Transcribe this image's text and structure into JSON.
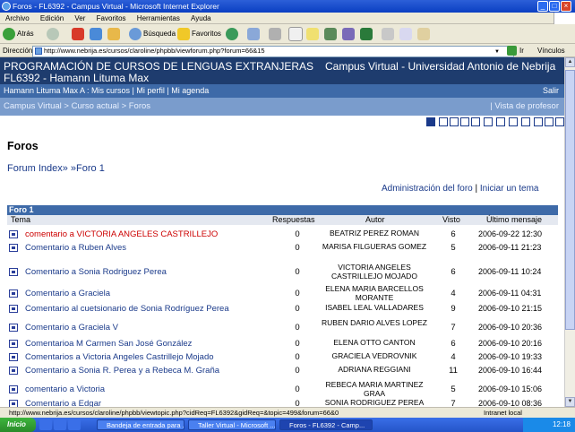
{
  "window": {
    "title": "Foros - FL6392 - Campus Virtual - Microsoft Internet Explorer"
  },
  "menu": [
    "Archivo",
    "Edición",
    "Ver",
    "Favoritos",
    "Herramientas",
    "Ayuda"
  ],
  "toolbar": {
    "back": "Atrás",
    "search": "Búsqueda",
    "favorites": "Favoritos"
  },
  "address": {
    "label": "Dirección",
    "url": "http://www.nebrija.es/cursos/claroline/phpbb/viewforum.php?forum=66&15",
    "go": "Ir",
    "links": "Vínculos"
  },
  "banner": {
    "line1": "PROGRAMACIÓN DE CURSOS DE LENGUAS EXTRANJERAS",
    "line2": "FL6392 - Hamann Lituma Max",
    "right": "Campus Virtual - Universidad Antonio de Nebrija"
  },
  "userbar": {
    "text": "Hamann Lituma Max A : Mis cursos | Mi perfil | Mi agenda",
    "logout": "Salir"
  },
  "crumbs": {
    "text": "Campus Virtual > Curso actual > Foros",
    "view": "|  Vista de profesor"
  },
  "page": {
    "title": "Foros",
    "nav": "Forum Index» »Foro 1"
  },
  "admin": {
    "admin_link": "Administración del foro",
    "sep": "|",
    "new_topic": "Iniciar un tema"
  },
  "forum": {
    "name": "Foro 1",
    "columns": {
      "tema": "Tema",
      "respuestas": "Respuestas",
      "autor": "Autor",
      "visto": "Visto",
      "ultimo": "Último mensaje"
    },
    "rows": [
      {
        "tema": "comentario a VICTORIA ANGELES CASTRILLEJO",
        "hot": true,
        "resp": "0",
        "autor": "BEATRIZ PEREZ ROMAN",
        "visto": "6",
        "ultimo": "2006-09-22 12:30"
      },
      {
        "tema": "Comentario a Ruben Alves",
        "resp": "0",
        "autor": "MARISA FILGUERAS GOMEZ",
        "visto": "5",
        "ultimo": "2006-09-11 21:23"
      },
      {
        "tema": "Comentario a Sonia Rodriguez Perea",
        "resp": "0",
        "autor": "VICTORIA ANGELES CASTRILLEJO MOJADO",
        "visto": "6",
        "ultimo": "2006-09-11 10:24"
      },
      {
        "tema": "Comentario a Graciela",
        "resp": "0",
        "autor": "ELENA MARIA BARCELLOS MORANTE",
        "visto": "4",
        "ultimo": "2006-09-11 04:31"
      },
      {
        "tema": "Comentario al cuetsionario de Sonia Rodríguez Perea",
        "resp": "0",
        "autor": "ISABEL LEAL VALLADARES",
        "visto": "9",
        "ultimo": "2006-09-10 21:15"
      },
      {
        "tema": "Comentario a Graciela V",
        "resp": "0",
        "autor": "RUBEN DARIO ALVES LOPEZ",
        "visto": "7",
        "ultimo": "2006-09-10 20:36"
      },
      {
        "tema": "Comentarioa M Carmen San José González",
        "resp": "0",
        "autor": "ELENA OTTO CANTON",
        "visto": "6",
        "ultimo": "2006-09-10 20:16"
      },
      {
        "tema": "Comentarios a Victoria Angeles Castrillejo Mojado",
        "resp": "0",
        "autor": "GRACIELA VEDROVNIK",
        "visto": "4",
        "ultimo": "2006-09-10 19:33"
      },
      {
        "tema": "Comentario a Sonia R. Perea y a Rebeca M. Graña",
        "resp": "0",
        "autor": "ADRIANA REGGIANI",
        "visto": "11",
        "ultimo": "2006-09-10 16:44"
      },
      {
        "tema": "comentario a Victoria",
        "resp": "0",
        "autor": "REBECA MARIA MARTINEZ GRAA",
        "visto": "5",
        "ultimo": "2006-09-10 15:06"
      },
      {
        "tema": "Comentario a Edgar",
        "resp": "0",
        "autor": "SONIA RODRIGUEZ PEREA",
        "visto": "7",
        "ultimo": "2006-09-10 08:36"
      }
    ]
  },
  "status": {
    "url": "http://www.nebrija.es/cursos/claroline/phpbb/viewtopic.php?cidReq=FL6392&gidReq=&topic=499&forum=66&0",
    "zone": "Intranet local"
  },
  "taskbar": {
    "start": "Inicio",
    "tasks": [
      "Bandeja de entrada para ...",
      "Taller Virtual - Microsoft ...",
      "Foros - FL6392 - Camp..."
    ],
    "clock": "12:18"
  }
}
